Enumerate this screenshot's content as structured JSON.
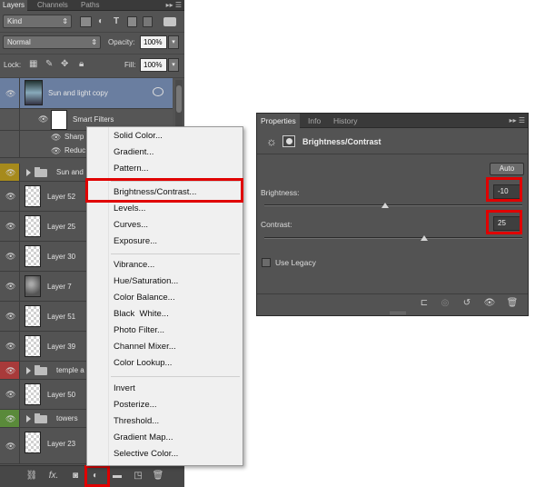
{
  "layers_panel": {
    "tabs": [
      "Layers",
      "Channels",
      "Paths"
    ],
    "filter_kind": "Kind",
    "blend_mode": "Normal",
    "opacity_label": "Opacity:",
    "opacity_value": "100%",
    "lock_label": "Lock:",
    "fill_label": "Fill:",
    "fill_value": "100%",
    "layers": [
      {
        "name": "Sun and light copy",
        "selected": true
      },
      {
        "name": "Smart Filters"
      },
      {
        "name": "Sharp"
      },
      {
        "name": "Reduc"
      },
      {
        "name": "Sun and",
        "group": true,
        "eye_color": "#a68a1c"
      },
      {
        "name": "Layer 52"
      },
      {
        "name": "Layer 25"
      },
      {
        "name": "Layer 30"
      },
      {
        "name": "Layer 7"
      },
      {
        "name": "Layer 51"
      },
      {
        "name": "Layer 39"
      },
      {
        "name": "temple a",
        "group": true,
        "eye_color": "#a83a3a"
      },
      {
        "name": "Layer 50"
      },
      {
        "name": "towers",
        "group": true,
        "eye_color": "#5a8a3a"
      },
      {
        "name": "Layer 23"
      }
    ],
    "bottom_icons": [
      "link-icon",
      "fx-icon",
      "mask-icon",
      "adjustment-icon",
      "folder-icon",
      "new-layer-icon",
      "trash-icon"
    ],
    "fx_label": "fx."
  },
  "adjustment_menu": {
    "items": [
      {
        "label": "Solid Color...",
        "section": 1
      },
      {
        "label": "Gradient...",
        "section": 1
      },
      {
        "label": "Pattern...",
        "section": 1
      },
      {
        "label": "Brightness/Contrast...",
        "section": 2,
        "highlighted": true
      },
      {
        "label": "Levels...",
        "section": 2
      },
      {
        "label": "Curves...",
        "section": 2
      },
      {
        "label": "Exposure...",
        "section": 2
      },
      {
        "label": "Vibrance...",
        "section": 3
      },
      {
        "label": "Hue/Saturation...",
        "section": 3
      },
      {
        "label": "Color Balance...",
        "section": 3
      },
      {
        "label": "Black  White...",
        "section": 3
      },
      {
        "label": "Photo Filter...",
        "section": 3
      },
      {
        "label": "Channel Mixer...",
        "section": 3
      },
      {
        "label": "Color Lookup...",
        "section": 3
      },
      {
        "label": "Invert",
        "section": 4
      },
      {
        "label": "Posterize...",
        "section": 4
      },
      {
        "label": "Threshold...",
        "section": 4
      },
      {
        "label": "Gradient Map...",
        "section": 4
      },
      {
        "label": "Selective Color...",
        "section": 4
      }
    ]
  },
  "properties_panel": {
    "tabs": [
      "Properties",
      "Info",
      "History"
    ],
    "title": "Brightness/Contrast",
    "auto_label": "Auto",
    "brightness": {
      "label": "Brightness:",
      "value": "-10",
      "slider_position": 0.47
    },
    "contrast": {
      "label": "Contrast:",
      "value": "25",
      "slider_position": 0.62
    },
    "use_legacy_label": "Use Legacy",
    "use_legacy_checked": false,
    "bottom_icons": [
      "clip-icon",
      "view-previous-icon",
      "reset-icon",
      "visibility-icon",
      "trash-icon"
    ]
  },
  "highlight_color": "#e00000"
}
